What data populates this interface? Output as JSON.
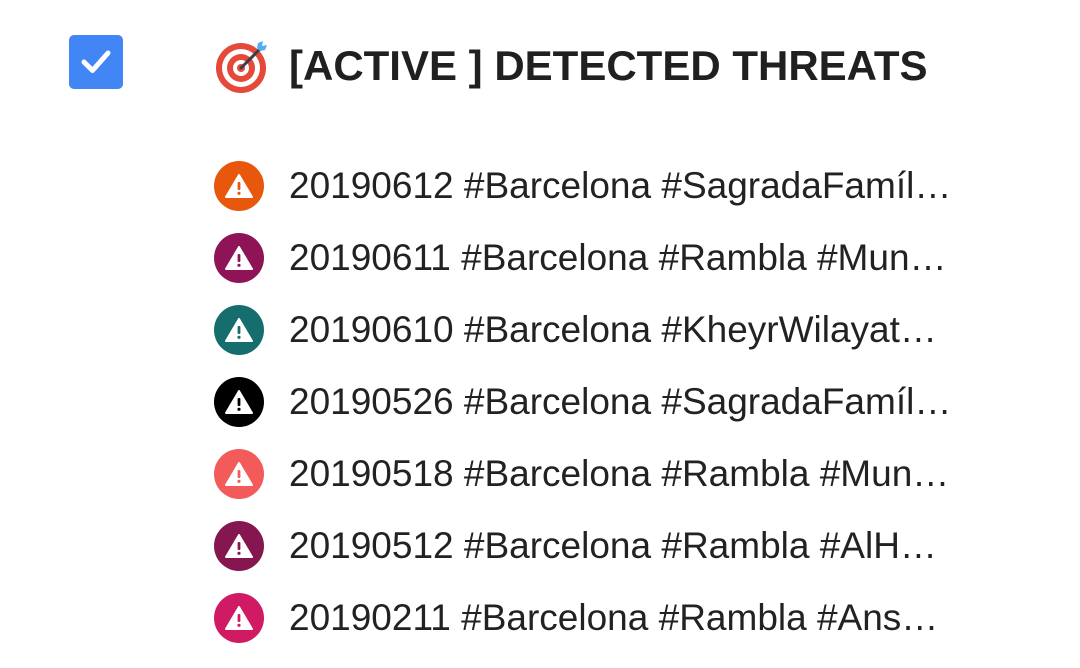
{
  "header": {
    "checked": true,
    "title": "[ACTIVE ] DETECTED THREATS",
    "title_icon": "direct-hit-target-icon",
    "checkbox_color": "#4285f4"
  },
  "threats": [
    {
      "label": "20190612 #Barcelona #SagradaFamíl…",
      "icon": "warning-icon",
      "color": "#e8580c"
    },
    {
      "label": "20190611 #Barcelona #Rambla #Mun…",
      "icon": "warning-icon",
      "color": "#8e1457"
    },
    {
      "label": "20190610 #Barcelona #KheyrWilayat…",
      "icon": "warning-icon",
      "color": "#166d6e"
    },
    {
      "label": "20190526 #Barcelona #SagradaFamíl…",
      "icon": "warning-icon",
      "color": "#000000"
    },
    {
      "label": "20190518 #Barcelona #Rambla #Mun…",
      "icon": "warning-icon",
      "color": "#f25b59"
    },
    {
      "label": "20190512 #Barcelona #Rambla #AlH…",
      "icon": "warning-icon",
      "color": "#86164f"
    },
    {
      "label": "20190211 #Barcelona #Rambla #Ans…",
      "icon": "warning-icon",
      "color": "#d11a64"
    }
  ]
}
